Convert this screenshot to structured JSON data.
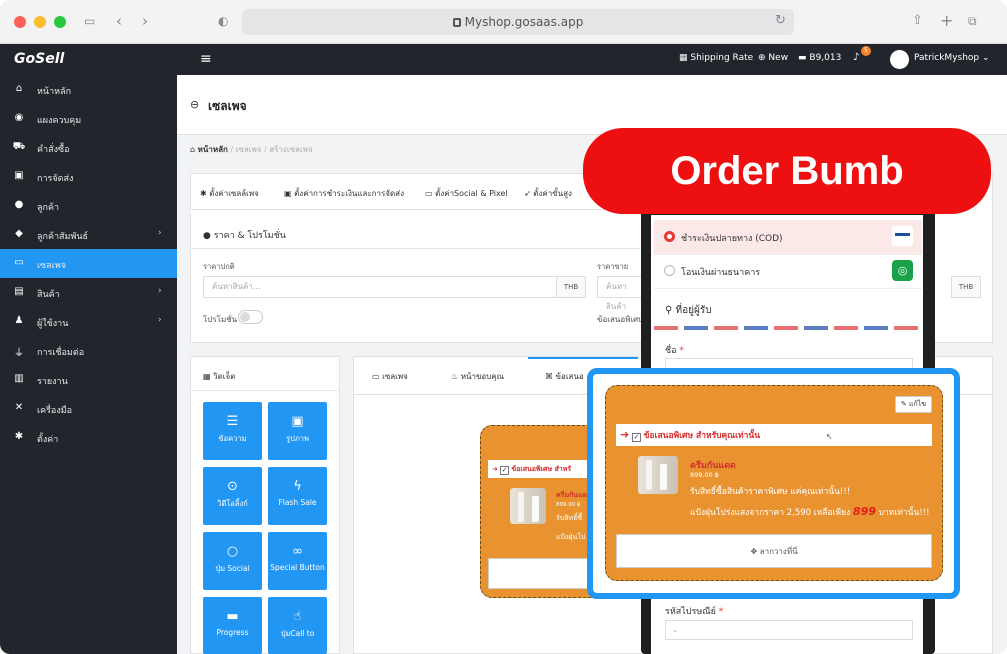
{
  "browser": {
    "url": "Myshop.gosaas.app"
  },
  "topbar": {
    "logo": "GoSell",
    "shipping_rate": "Shipping Rate",
    "new": "New",
    "credit": "B9,013",
    "notification_count": "5",
    "user": "PatrickMyshop"
  },
  "sidebar": {
    "items": [
      {
        "label": "หน้าหลัก",
        "icon": "home-icon"
      },
      {
        "label": "แผงควบคุม",
        "icon": "dashboard-icon"
      },
      {
        "label": "คำสั่งซื้อ",
        "icon": "cart-icon"
      },
      {
        "label": "การจัดส่ง",
        "icon": "truck-icon"
      },
      {
        "label": "ลูกค้า",
        "icon": "users-icon"
      },
      {
        "label": "ลูกค้าสัมพันธ์",
        "icon": "crm-icon"
      },
      {
        "label": "เซลเพจ",
        "icon": "salepage-icon"
      },
      {
        "label": "สินค้า",
        "icon": "box-icon"
      },
      {
        "label": "ผู้ใช้งาน",
        "icon": "user-group-icon"
      },
      {
        "label": "การเชื่อมต่อ",
        "icon": "plug-icon"
      },
      {
        "label": "รายงาน",
        "icon": "report-icon"
      },
      {
        "label": "เครื่องมือ",
        "icon": "tools-icon"
      },
      {
        "label": "ตั้งค่า",
        "icon": "gear-icon"
      }
    ]
  },
  "page": {
    "title": "เซลเพจ",
    "breadcrumb": {
      "home": "หน้าหลัก",
      "sep": "/",
      "b1": "เซลเพจ",
      "b2": "สร้างเซลเพจ"
    },
    "tabs": [
      "ตั้งค่าเซลล์เพจ",
      "ตั้งค่าการชำระเงินและการจัดส่ง",
      "ตั้งค่าSocial & Pixel",
      "ตั้งค่าขั้นสูง"
    ],
    "price_section": "ราคา & โปรโมชั่น",
    "regular_price_label": "ราคาปกติ",
    "regular_price_placeholder": "ค้นหาสินค้า...",
    "sale_price_label": "ราคาขาย",
    "sale_price_placeholder": "ค้นหาสินค้า",
    "currency": "THB",
    "promotion_label": "โปรโมชั่น",
    "special_offer_label": "ข้อเสนอพิเศษ"
  },
  "widgets": {
    "title": "วิดเจ็ต",
    "buttons": [
      "ข้อความ",
      "รูปภาพ",
      "วิดีโอลิ้งก์",
      "Flash Sale",
      "ปุ่ม Social",
      "Special Button",
      "Progress",
      "ปุ่มCall to"
    ]
  },
  "editor_tabs": [
    "เซลเพจ",
    "หน้าขอบคุณ",
    "ข้อเสนอ"
  ],
  "bump": {
    "edit": "แก้ไข",
    "header": "ข้อเสนอพิเศษ สำหรับคุณเท่านั้น",
    "header_short": "ข้อเสนอพิเศษ สำหรั",
    "product_name": "ครีมกันแดด",
    "product_name_short": "ครีมกันแด",
    "product_price": "899.00 ฿",
    "line1": "รับสิทธิ์ซื้อสินค้าราคาพิเศษ แค่คุณเท่านั้น!!!",
    "line1_short": "รับสิทธิ์ซื้",
    "line2_pre": "แป้งฝุ่นโปร่งแสงจากราคา 2,590 เหลือเพียง",
    "line2_price": "899",
    "line2_post": "บาทเท่านั้น!!!",
    "line2_short": "แป้งฝุ่นโป",
    "drag": "ลากวางที่นี่"
  },
  "phone": {
    "cod": "ชำระเงินปลายทาง (COD)",
    "transfer": "โอนเงินผ่านธนาคาร",
    "address_title": "ที่อยู่ผู้รับ",
    "name_label": "ชื่อ",
    "required": "*",
    "postcode_label": "รหัสไปรษณีย์"
  },
  "promo_banner": "Order Bumb",
  "colors": {
    "accent": "#2196f3",
    "banner": "#ee1010",
    "bump_bg": "#e8932f",
    "sidebar": "#22252b"
  }
}
